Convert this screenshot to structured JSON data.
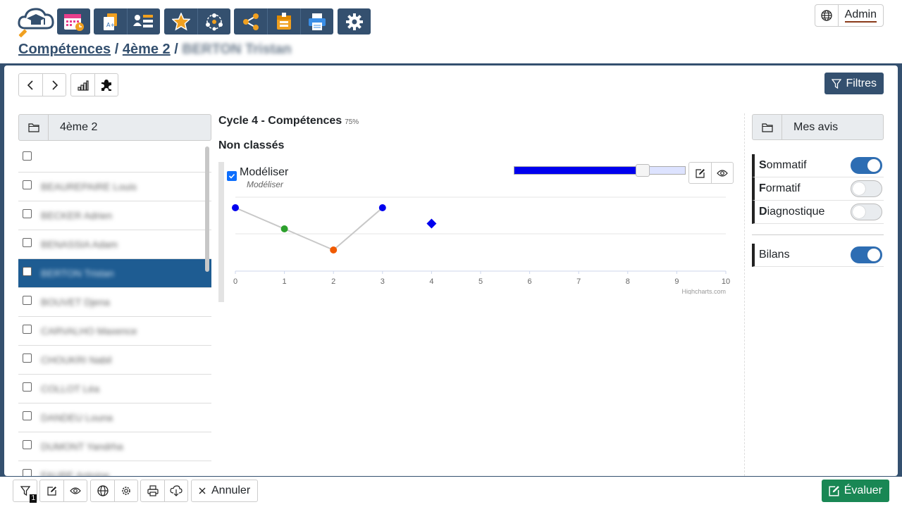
{
  "breadcrumb": {
    "root": "Compétences",
    "classe": "4ème 2",
    "student": "BERTON Tristan"
  },
  "header": {
    "admin_label": "Admin"
  },
  "toolbar": {
    "filtres_label": "Filtres"
  },
  "classe": {
    "label": "4ème 2",
    "students": [
      "",
      "BEAUREPAIRE Louis",
      "BECKER Adrien",
      "BENASSIA Adam",
      "BERTON Tristan",
      "BOUVET Djena",
      "CARVALHO Maxence",
      "CHOUKRI Nabil",
      "COLLOT Léa",
      "DANDEU Louna",
      "DUMONT Yandrha",
      "FAURE Antoine"
    ],
    "selected_index": 4
  },
  "competence": {
    "title": "Cycle 4 - Compétences",
    "percent": "75%",
    "group": "Non classés",
    "name": "Modéliser",
    "subname": "Modéliser",
    "slider_value": 0.75
  },
  "chart_data": {
    "type": "line",
    "x_ticks": [
      "0",
      "1",
      "2",
      "3",
      "4",
      "5",
      "6",
      "7",
      "8",
      "9",
      "10"
    ],
    "xlim": [
      0,
      10
    ],
    "ylim": [
      0,
      3
    ],
    "grid": true,
    "points": [
      {
        "x": 0,
        "y": 3,
        "color": "#0000ee",
        "shape": "circle"
      },
      {
        "x": 1,
        "y": 2,
        "color": "#2ca02c",
        "shape": "circle"
      },
      {
        "x": 2,
        "y": 1,
        "color": "#f05a00",
        "shape": "circle"
      },
      {
        "x": 3,
        "y": 3,
        "color": "#0000ee",
        "shape": "circle"
      },
      {
        "x": 4,
        "y": 2.25,
        "color": "#0000ee",
        "shape": "diamond"
      }
    ],
    "line_color": "#c8c8c8",
    "credits": "Highcharts.com"
  },
  "avis": {
    "label": "Mes avis",
    "toggles": [
      {
        "first": "S",
        "rest": "ommatif",
        "on": true
      },
      {
        "first": "F",
        "rest": "ormatif",
        "on": false
      },
      {
        "first": "D",
        "rest": "iagnostique",
        "on": false
      }
    ],
    "bilans": {
      "label": "Bilans",
      "on": true
    }
  },
  "bottom": {
    "filter_badge": "1",
    "annuler_label": "Annuler",
    "evaluer_label": "Évaluer"
  },
  "colors": {
    "primary": "#34506f",
    "selected": "#1e5c92",
    "success": "#198754"
  }
}
